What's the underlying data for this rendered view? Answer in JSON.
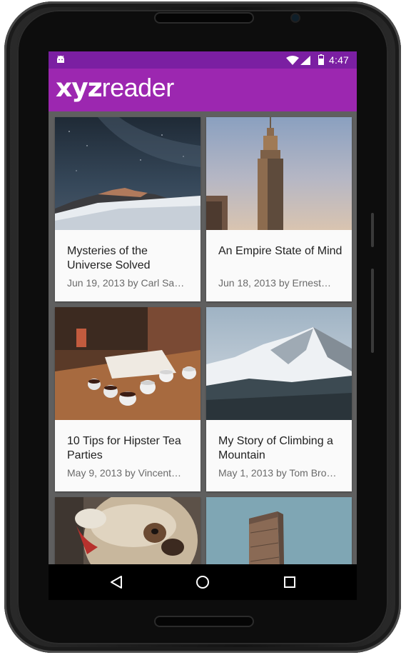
{
  "status_bar": {
    "time": "4:47",
    "icons": [
      "android-icon",
      "wifi-icon",
      "signal-icon",
      "battery-icon"
    ],
    "background": "#7b1fa2"
  },
  "app_bar": {
    "logo_bold": "xyz",
    "logo_light": "reader",
    "background": "#9c27b0"
  },
  "articles": [
    {
      "title": "Mysteries of the Universe Solved",
      "meta": "Jun 19, 2013 by Carl Sa…",
      "image": "night sky over mountain"
    },
    {
      "title": "An Empire State of Mind",
      "meta": "Jun 18, 2013 by Ernest…",
      "image": "empire state building"
    },
    {
      "title": "10 Tips for Hipster Tea Parties",
      "meta": "May 9, 2013 by Vincent…",
      "image": "tea cups on wooden table"
    },
    {
      "title": "My Story of Climbing a Mountain",
      "meta": "May 1, 2013 by Tom Bro…",
      "image": "snowy mountain"
    },
    {
      "title": "",
      "meta": "",
      "image": "bulldog"
    },
    {
      "title": "",
      "meta": "",
      "image": "flatiron building"
    }
  ],
  "nav_bar": {
    "buttons": [
      "back-icon",
      "home-icon",
      "recents-icon"
    ]
  }
}
